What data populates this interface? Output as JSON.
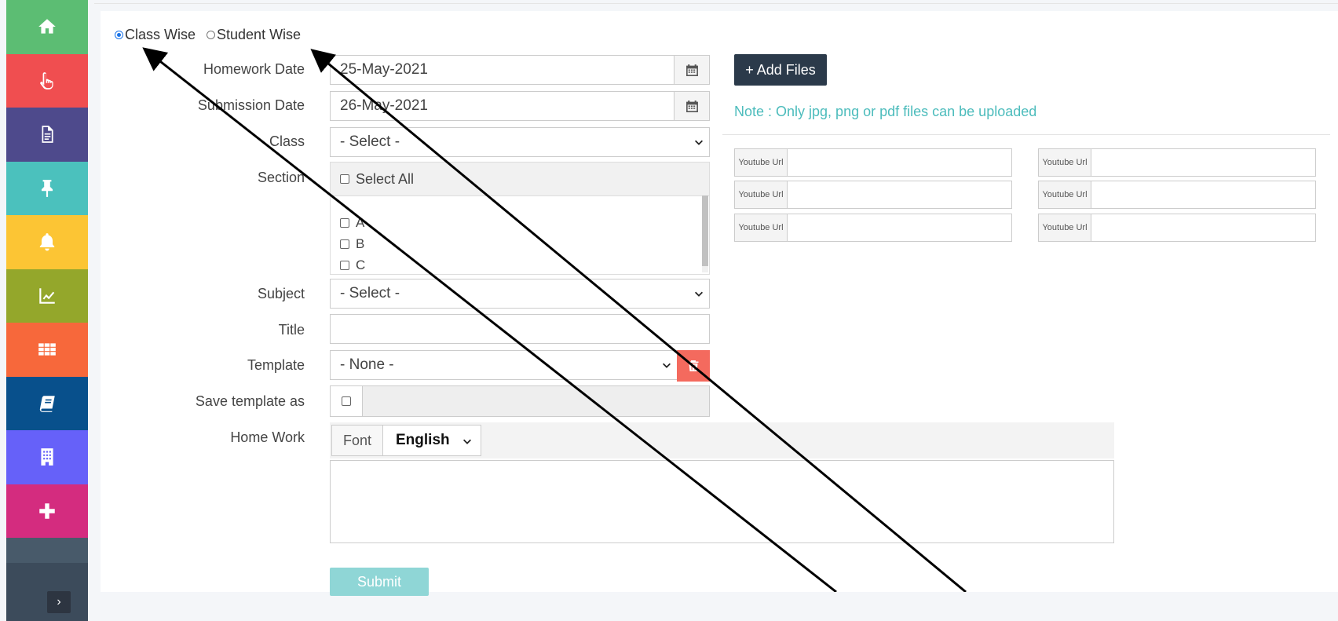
{
  "sidebar": {
    "items": [
      {
        "icon": "home-icon",
        "color": "#5cbd73"
      },
      {
        "icon": "hand-pointer-icon",
        "color": "#f04e50"
      },
      {
        "icon": "document-icon",
        "color": "#4e4a8c"
      },
      {
        "icon": "pin-icon",
        "color": "#4bc1bd"
      },
      {
        "icon": "bell-icon",
        "color": "#fcc534"
      },
      {
        "icon": "chart-line-icon",
        "color": "#94a72b"
      },
      {
        "icon": "grid-icon",
        "color": "#f7683b"
      },
      {
        "icon": "book-icon",
        "color": "#08508c"
      },
      {
        "icon": "building-icon",
        "color": "#6661f9"
      },
      {
        "icon": "plus-icon",
        "color": "#d42c7f"
      }
    ],
    "toggle_glyph": "›",
    "toggle_bg": "#485a6a"
  },
  "mode": {
    "options": [
      "Class Wise",
      "Student Wise"
    ],
    "selected": "Class Wise"
  },
  "form": {
    "homework_date": {
      "label": "Homework Date",
      "value": "25-May-2021"
    },
    "submission_date": {
      "label": "Submission Date",
      "value": "26-May-2021"
    },
    "class": {
      "label": "Class",
      "value": "- Select -"
    },
    "section": {
      "label": "Section",
      "select_all": "Select All",
      "options": [
        "A",
        "B",
        "C"
      ]
    },
    "subject": {
      "label": "Subject",
      "value": "- Select -"
    },
    "title": {
      "label": "Title",
      "value": ""
    },
    "template": {
      "label": "Template",
      "value": "- None -"
    },
    "save_template": {
      "label": "Save template as",
      "value": ""
    },
    "homework": {
      "label": "Home Work",
      "font_label": "Font",
      "font_value": "English"
    },
    "submit_label": "Submit"
  },
  "files": {
    "add_label": "+ Add Files",
    "note": "Note : Only jpg, png or pdf files can be uploaded",
    "youtube_label": "Youtube Url"
  },
  "colors": {
    "accent": "#1a73e8",
    "note": "#4cbcbc",
    "danger": "#f46a5e",
    "dark_button": "#2b3a4a",
    "submit": "#8fd6d6"
  }
}
